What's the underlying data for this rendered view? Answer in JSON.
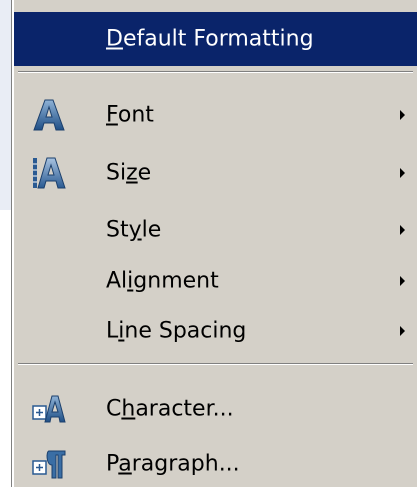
{
  "menu": {
    "default_formatting": {
      "label": "Default Formatting",
      "mnemonic": "D"
    },
    "font": {
      "label": "Font",
      "mnemonic": "F",
      "icon": "font-a-icon"
    },
    "size": {
      "label": "Size",
      "mnemonic": "z",
      "icon": "font-size-a-icon"
    },
    "style": {
      "label": "Style",
      "mnemonic": "y"
    },
    "alignment": {
      "label": "Alignment",
      "mnemonic": "i"
    },
    "line_spacing": {
      "label": "Line Spacing",
      "mnemonic": "i"
    },
    "character": {
      "label": "Character...",
      "mnemonic": "h",
      "icon": "character-dialog-icon"
    },
    "paragraph": {
      "label": "Paragraph...",
      "mnemonic": "a",
      "icon": "paragraph-dialog-icon"
    }
  },
  "colors": {
    "menu_bg": "#d4d0c8",
    "highlight": "#0a246a",
    "highlight_text": "#ffffff",
    "icon_blue": "#3a6ea5"
  }
}
